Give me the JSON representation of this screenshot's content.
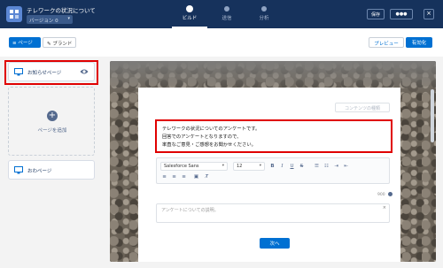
{
  "header": {
    "title": "テレワークの状況について",
    "version": "バージョン 0",
    "steps": [
      {
        "label": "ビルド",
        "active": true
      },
      {
        "label": "送信",
        "active": false
      },
      {
        "label": "分析",
        "active": false
      }
    ],
    "save_label": "保存",
    "more_label": "●●●",
    "close_label": "×"
  },
  "toolbar": {
    "page_tab": "ページ",
    "brand_tab": "ブランド",
    "preview_label": "プレビュー",
    "activate_label": "有効化"
  },
  "left": {
    "pages": [
      {
        "label": "お知らせページ"
      },
      {
        "label": "おわページ"
      }
    ],
    "add_page_label": "ページを追加"
  },
  "canvas": {
    "content_type_button": "コンテンツの種類",
    "message_lines": [
      "テレワークの状況についてのアンケートです。",
      "回答でのアンケートとなりますので、",
      "率直なご意見・ご感想をお聞かせください。"
    ],
    "font_name": "Salesforce Sans",
    "font_size": "12",
    "char_count": "900",
    "answer_placeholder": "アンケートについての説明。",
    "next_button": "次へ"
  },
  "colors": {
    "header_bg": "#16325c",
    "brand_blue": "#0070d2",
    "highlight_red": "#e00000"
  }
}
